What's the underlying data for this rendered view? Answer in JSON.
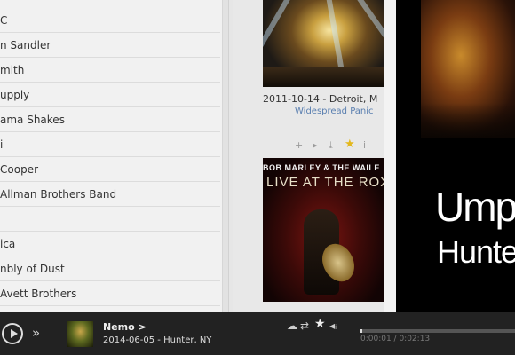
{
  "sidebar": {
    "artists": [
      "C",
      "n Sandler",
      "mith",
      "upply",
      "ama Shakes",
      "i",
      "Cooper",
      "Allman Brothers Band",
      "",
      "ica",
      "nbly of Dust",
      "Avett Brothers"
    ]
  },
  "albums": [
    {
      "date": "2011-10-14 - Detroit, M",
      "artist": "Widespread Panic",
      "cover": "concert-photo"
    },
    {
      "date": "",
      "artist": "",
      "cover_band": "BOB MARLEY & THE WAILE",
      "cover_title": "LIVE AT THE ROX"
    }
  ],
  "album_tools": {
    "icons": [
      "plus-icon",
      "play-icon",
      "download-icon",
      "star-icon",
      "info-icon"
    ],
    "glyphs": [
      "+",
      "▸",
      "⤓",
      "★",
      "i"
    ]
  },
  "overlay": {
    "title": "Umph",
    "subtitle": "Hunter,"
  },
  "player": {
    "track_title": "Nemo >",
    "track_subtitle": "2014-06-05 - Hunter, NY",
    "controls": [
      "cloud-icon",
      "repeat-icon",
      "star-icon",
      "volume-icon"
    ],
    "control_glyphs": [
      "☁",
      "⇄",
      "★",
      "◂ᵢ"
    ],
    "time": "0:00:01 / 0:02:13",
    "progress": 0.01
  },
  "colors": {
    "link": "#5a7fb0",
    "star": "#e3b81e",
    "player_bg": "#222222"
  }
}
